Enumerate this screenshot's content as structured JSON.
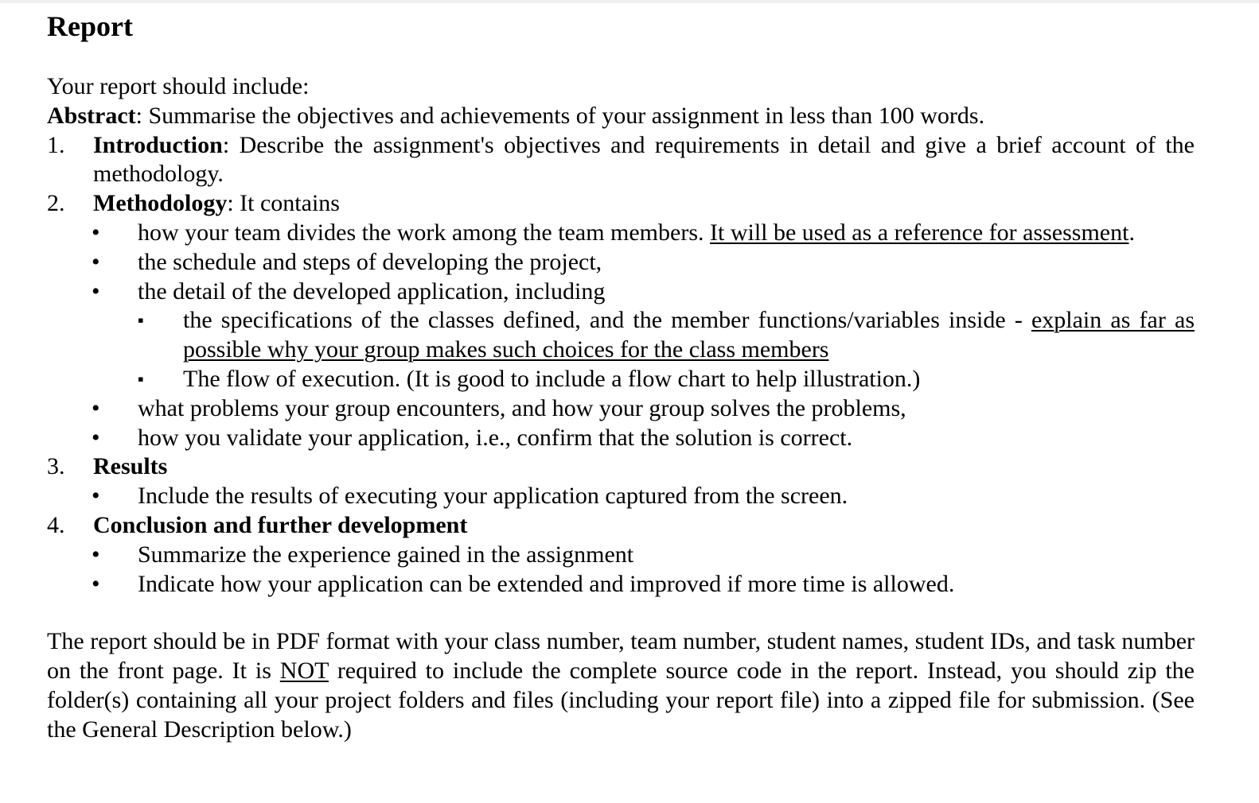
{
  "document": {
    "title": "Report",
    "intro": "Your report should include:",
    "abstract": {
      "label": "Abstract",
      "text": ": Summarise the objectives and achievements of your assignment in less than 100 words."
    },
    "sections": [
      {
        "number": "1.",
        "label": "Introduction",
        "text": ": Describe the assignment's objectives and requirements in detail and give a brief account of the methodology."
      },
      {
        "number": "2.",
        "label": "Methodology",
        "text": ": It contains",
        "bullets": [
          {
            "text": "how your team divides the work among the team members. ",
            "underlined": "It will be used as a reference for assessment",
            "after": "."
          },
          {
            "text": "the schedule and steps of developing the project,"
          },
          {
            "text": "the detail of the developed application, including",
            "subbullets": [
              {
                "text": "the specifications of the classes defined, and the member functions/variables inside - ",
                "underlined": "explain as far as possible why your group makes such choices for the class members"
              },
              {
                "text": "The flow of execution. (It is good to include a flow chart to help illustration.)"
              }
            ]
          },
          {
            "text": "what problems your group encounters, and how your group solves the problems,"
          },
          {
            "text": "how you validate your application, i.e., confirm that the solution is correct."
          }
        ]
      },
      {
        "number": "3.",
        "label": "Results",
        "bullets": [
          {
            "text": "Include the results of executing your application captured from the screen."
          }
        ]
      },
      {
        "number": "4.",
        "label": "Conclusion and further development",
        "bullets": [
          {
            "text": "Summarize the experience gained in the assignment"
          },
          {
            "text": "Indicate how your application can be extended and improved if more time is allowed."
          }
        ]
      }
    ],
    "closing": {
      "before": "The report should be in PDF format with your class number, team number, student names, student IDs, and task number on the front page. It is ",
      "underlined": "NOT",
      "after": " required to include the complete source code in the report. Instead, you should zip the folder(s) containing all your project folders and files (including your report file) into a zipped file for submission. (See the General Description below.)"
    },
    "bullet_glyph": "•",
    "subbullet_glyph": "▪"
  }
}
